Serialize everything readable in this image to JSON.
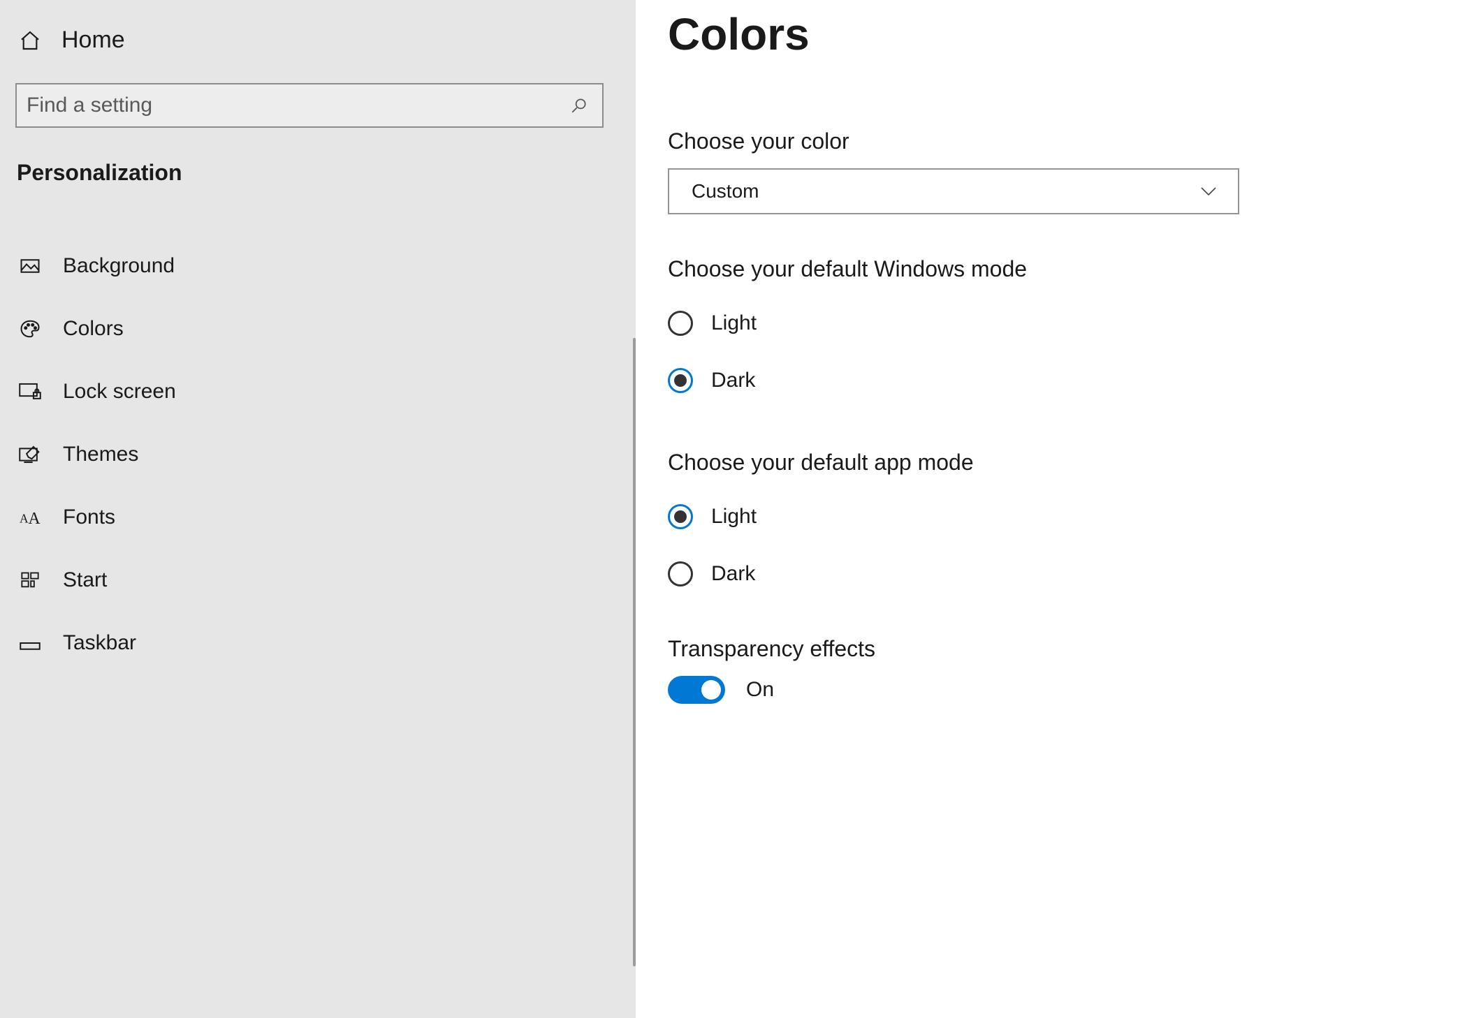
{
  "sidebar": {
    "home_label": "Home",
    "search_placeholder": "Find a setting",
    "section_title": "Personalization",
    "items": [
      {
        "label": "Background",
        "icon": "picture-icon"
      },
      {
        "label": "Colors",
        "icon": "palette-icon"
      },
      {
        "label": "Lock screen",
        "icon": "lockscreen-icon"
      },
      {
        "label": "Themes",
        "icon": "themes-icon"
      },
      {
        "label": "Fonts",
        "icon": "fonts-icon"
      },
      {
        "label": "Start",
        "icon": "start-icon"
      },
      {
        "label": "Taskbar",
        "icon": "taskbar-icon"
      }
    ]
  },
  "main": {
    "title": "Colors",
    "choose_color": {
      "label": "Choose your color",
      "value": "Custom"
    },
    "windows_mode": {
      "label": "Choose your default Windows mode",
      "options": [
        "Light",
        "Dark"
      ],
      "selected": "Dark"
    },
    "app_mode": {
      "label": "Choose your default app mode",
      "options": [
        "Light",
        "Dark"
      ],
      "selected": "Light"
    },
    "transparency": {
      "label": "Transparency effects",
      "state_label": "On",
      "value": true
    }
  },
  "colors": {
    "accent": "#0078d4"
  }
}
